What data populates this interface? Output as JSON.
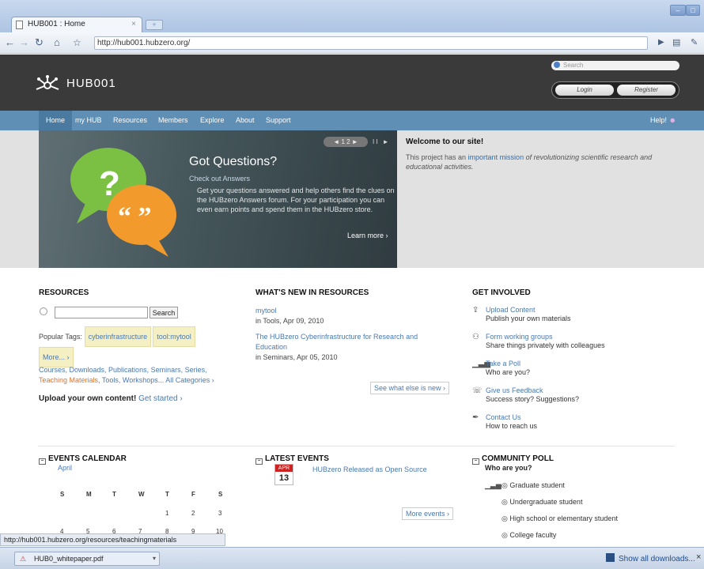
{
  "browser": {
    "tab_title": "HUB001 : Home",
    "tab_close": "×",
    "url": "http://hub001.hubzero.org/",
    "status_url": "http://hub001.hubzero.org/resources/teachingmaterials",
    "download_file": "HUB0_whitepaper.pdf",
    "show_all_downloads": "Show all downloads...",
    "close_downloads": "×"
  },
  "header": {
    "site_name": "HUB001",
    "search_placeholder": "Search",
    "login_label": "Login",
    "register_label": "Register"
  },
  "nav": {
    "items": [
      "Home",
      "my HUB",
      "Resources",
      "Members",
      "Explore",
      "About",
      "Support"
    ],
    "help_label": "Help!"
  },
  "slider": {
    "controls": "◄ 1 2 ►",
    "pause": "II ►",
    "title": "Got Questions?",
    "subtitle": "Check out Answers",
    "body": "Get your questions answered and help others find the clues on the HUBzero Answers forum. For your participation you can even earn points and spend them in the HUBzero store.",
    "learn_more": "Learn more ›"
  },
  "welcome": {
    "title": "Welcome to our site!",
    "text_before": "This project has an ",
    "link": "important mission",
    "text_after": " of revolutionizing scientific research and educational activities."
  },
  "resources": {
    "title": "RESOURCES",
    "search_button": "Search",
    "popular_tags_label": "Popular Tags:",
    "tags": [
      "cyberinfrastructure",
      "tool:mytool"
    ],
    "more_tag": "More... ›",
    "categories": "Courses, Downloads, Publications, Seminars, Series,",
    "teaching": "Teaching Materials",
    "categories2": ", Tools, Workshops... All Categories ›",
    "upload_text": "Upload your own content!",
    "get_started": "Get started ›"
  },
  "whats_new": {
    "title": "WHAT'S NEW IN RESOURCES",
    "items": [
      {
        "title": "mytool",
        "meta": "in Tools, Apr 09, 2010"
      },
      {
        "title": "The HUBzero Cyberinfrastructure for Research and Education",
        "meta": "in Seminars, Apr 05, 2010"
      }
    ],
    "see_more": "See what else is new ›"
  },
  "get_involved": {
    "title": "GET INVOLVED",
    "items": [
      {
        "link": "Upload Content",
        "desc": "Publish your own materials"
      },
      {
        "link": "Form working groups",
        "desc": "Share things privately with colleagues"
      },
      {
        "link": "Take a Poll",
        "desc": "Who are you?"
      },
      {
        "link": "Give us Feedback",
        "desc": "Success story? Suggestions?"
      },
      {
        "link": "Contact Us",
        "desc": "How to reach us"
      }
    ]
  },
  "events_calendar": {
    "title": "EVENTS CALENDAR",
    "month": "April",
    "day_headers": [
      "S",
      "M",
      "T",
      "W",
      "T",
      "F",
      "S"
    ],
    "week1": [
      "1",
      "2",
      "3"
    ],
    "week2": [
      "4",
      "5",
      "6",
      "7",
      "8",
      "9",
      "10"
    ]
  },
  "latest_events": {
    "title": "LATEST EVENTS",
    "month": "APR",
    "day": "13",
    "event": "HUBzero Released as Open Source",
    "more": "More events ›"
  },
  "poll": {
    "title": "COMMUNITY POLL",
    "question": "Who are you?",
    "options": [
      "Graduate student",
      "Undergraduate student",
      "High school or elementary student",
      "College faculty"
    ]
  },
  "colors": {
    "nav_bar": "#5f8fb5",
    "header_bg": "#3a3a3a",
    "link": "#4a79b1",
    "highlight": "#e0722a",
    "event_red": "#cc2222"
  }
}
